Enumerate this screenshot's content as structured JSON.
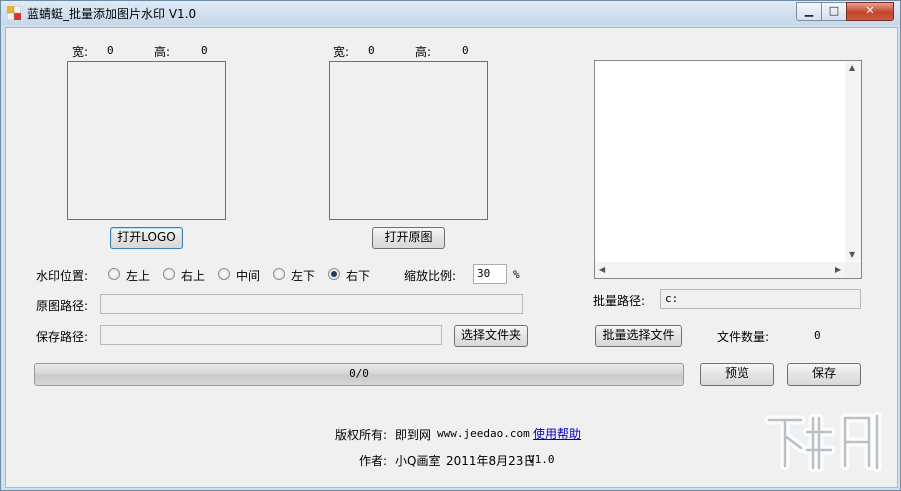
{
  "window": {
    "title": "蓝蜻蜓_批量添加图片水印 V1.0",
    "controls": {
      "minimize": "▁",
      "maximize": "□",
      "close": "✕"
    }
  },
  "logo_panel": {
    "width_label": "宽:",
    "width_value": "0",
    "height_label": "高:",
    "height_value": "0",
    "open_button": "打开LOGO"
  },
  "original_panel": {
    "width_label": "宽:",
    "width_value": "0",
    "height_label": "高:",
    "height_value": "0",
    "open_button": "打开原图"
  },
  "watermark_position": {
    "label": "水印位置:",
    "options": [
      "左上",
      "右上",
      "中间",
      "左下",
      "右下"
    ],
    "selected": "右下"
  },
  "scale": {
    "label": "缩放比例:",
    "value": "30",
    "unit": "%"
  },
  "original_path": {
    "label": "原图路径:",
    "value": ""
  },
  "save_path": {
    "label": "保存路径:",
    "value": "",
    "choose_button": "选择文件夹"
  },
  "batch": {
    "path_label": "批量路径:",
    "path_value": "c:",
    "select_button": "批量选择文件",
    "count_label": "文件数量:",
    "count_value": "0"
  },
  "progress": {
    "text": "0/0",
    "fraction": 0
  },
  "actions": {
    "preview": "预览",
    "save": "保存"
  },
  "footer": {
    "copyright_label": "版权所有:",
    "site_name": "即到网",
    "site_url": "www.jeedao.com",
    "help_link": "使用帮助",
    "author_label": "作者:",
    "author_name": "小Q画室",
    "date": "2011年8月23日",
    "version": "V1.0"
  },
  "watermark_logo": {
    "text": "下载吧",
    "url": "www.xiazaiba.com"
  }
}
